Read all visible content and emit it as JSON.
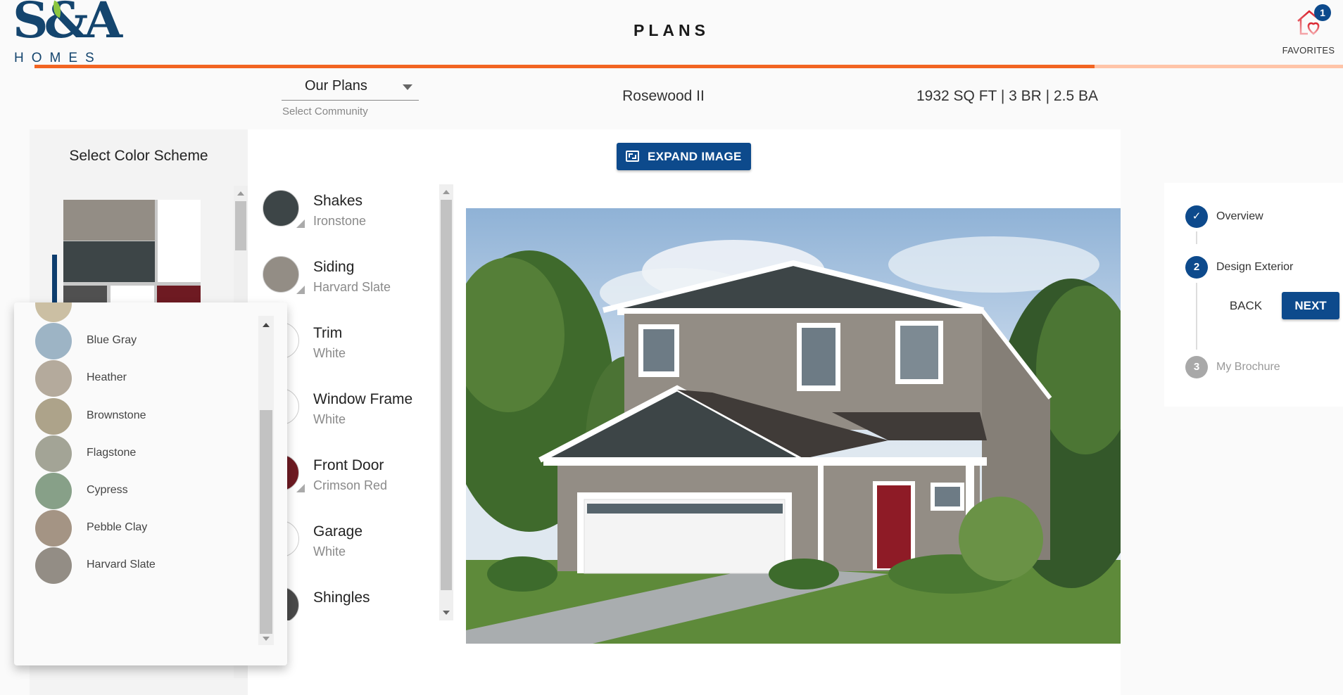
{
  "header": {
    "logo_text": "S&A",
    "logo_subtext": "HOMES",
    "title": "PLANS",
    "favorites_label": "FAVORITES",
    "favorites_count": "1",
    "progress_percent": 81
  },
  "subheader": {
    "community_select_value": "Our Plans",
    "community_select_label": "Select Community",
    "plan_name": "Rosewood II",
    "plan_specs": "1932 SQ FT | 3 BR | 2.5 BA"
  },
  "scheme_panel": {
    "title": "Select Color Scheme",
    "selected_scheme_colors": {
      "siding": "#938d85",
      "shakes": "#3d4547",
      "trim": "#ffffff",
      "shingles": "#505050",
      "garage": "#ffffff",
      "door": "#6e1a22"
    }
  },
  "expand_button": {
    "label": "EXPAND IMAGE",
    "icon": "expand-icon"
  },
  "color_components": [
    {
      "name": "Shakes",
      "value": "Ironstone",
      "color": "#3d4547",
      "editable": true
    },
    {
      "name": "Siding",
      "value": "Harvard Slate",
      "color": "#938d85",
      "editable": true
    },
    {
      "name": "Trim",
      "value": "White",
      "color": "#ffffff",
      "editable": false
    },
    {
      "name": "Window Frame",
      "value": "White",
      "color": "#ffffff",
      "editable": false
    },
    {
      "name": "Front Door",
      "value": "Crimson Red",
      "color": "#6e1a22",
      "editable": true
    },
    {
      "name": "Garage",
      "value": "White",
      "color": "#ffffff",
      "editable": false
    },
    {
      "name": "Shingles",
      "value": "",
      "color": "#4a4a4a",
      "editable": false
    }
  ],
  "siding_dropdown": {
    "options": [
      {
        "name": "",
        "color": "#cbbfa3"
      },
      {
        "name": "Blue Gray",
        "color": "#9db4c5"
      },
      {
        "name": "Heather",
        "color": "#b4aa9c"
      },
      {
        "name": "Brownstone",
        "color": "#ada38a"
      },
      {
        "name": "Flagstone",
        "color": "#a3a496"
      },
      {
        "name": "Cypress",
        "color": "#87a088"
      },
      {
        "name": "Pebble Clay",
        "color": "#a49484"
      },
      {
        "name": "Harvard Slate",
        "color": "#938d85"
      }
    ]
  },
  "steps": [
    {
      "number": "✓",
      "label": "Overview",
      "state": "complete"
    },
    {
      "number": "2",
      "label": "Design Exterior",
      "state": "active"
    },
    {
      "number": "3",
      "label": "My Brochure",
      "state": "pending"
    }
  ],
  "nav": {
    "back_label": "BACK",
    "next_label": "NEXT"
  },
  "colors": {
    "brand_blue": "#0d4a8c",
    "accent_orange": "#f26522",
    "logo_navy": "#14456e"
  }
}
